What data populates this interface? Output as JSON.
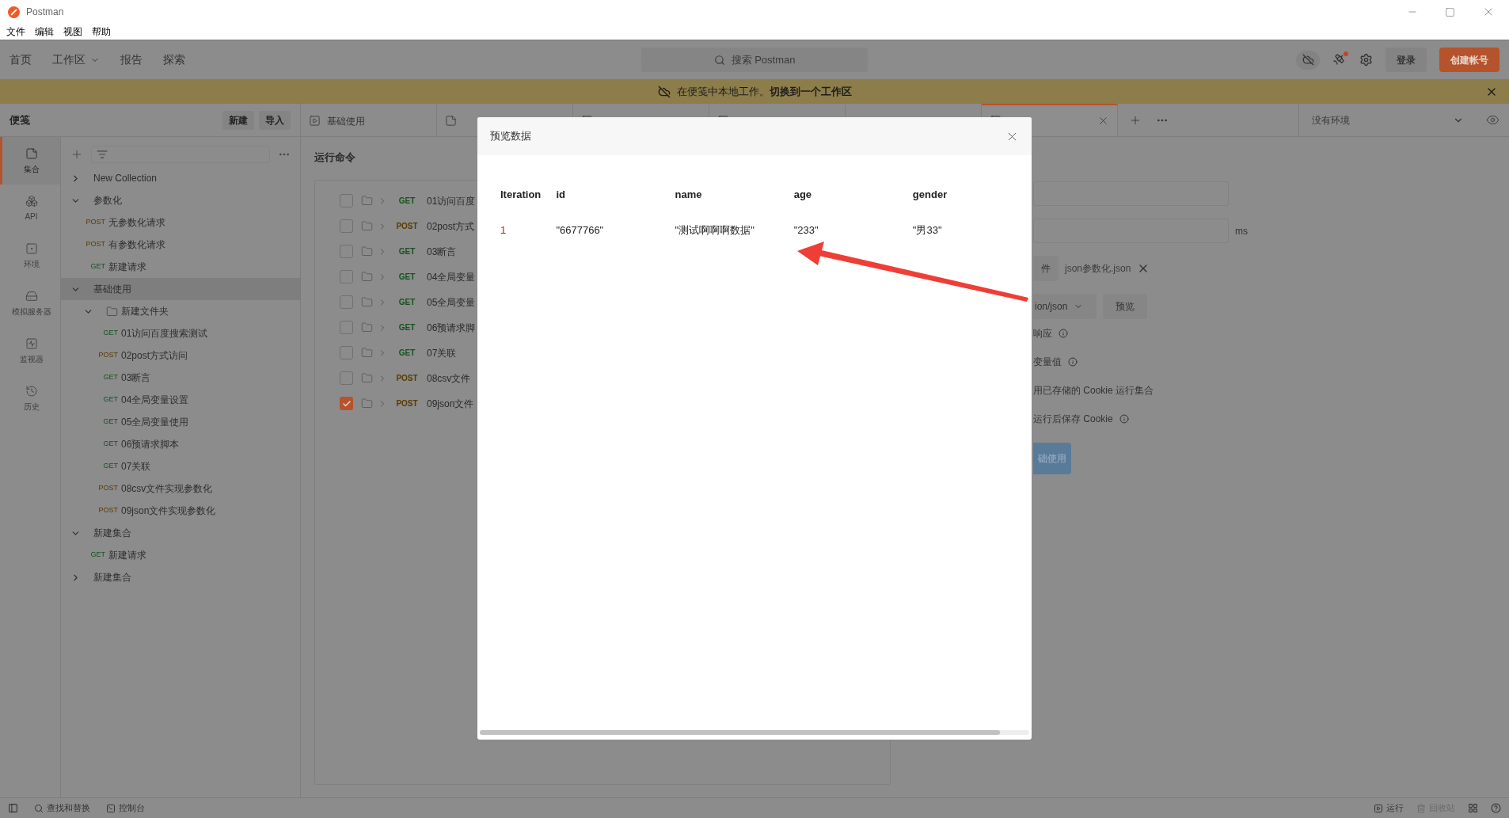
{
  "window": {
    "title": "Postman"
  },
  "menu": [
    "文件",
    "编辑",
    "视图",
    "帮助"
  ],
  "header": {
    "nav": [
      {
        "label": "首页",
        "dropdown": false
      },
      {
        "label": "工作区",
        "dropdown": true
      },
      {
        "label": "报告",
        "dropdown": false
      },
      {
        "label": "探索",
        "dropdown": false
      }
    ],
    "search": {
      "placeholder": "搜索 Postman"
    },
    "notification_dot": true,
    "buttons": [
      {
        "label": "登录",
        "kind": "secondary"
      },
      {
        "label": "创建帐号",
        "kind": "primary"
      }
    ]
  },
  "banner": {
    "text": "在便笺中本地工作。**切换到一个工作区**"
  },
  "sidebar": {
    "title": "便笺",
    "buttons": [
      "新建",
      "导入"
    ],
    "rail": [
      {
        "label": "集合",
        "selected": true
      },
      {
        "label": "API",
        "selected": false
      },
      {
        "label": "环境",
        "selected": false
      },
      {
        "label": "模拟服务器",
        "selected": false
      },
      {
        "label": "监视器",
        "selected": false
      },
      {
        "label": "历史",
        "selected": false
      }
    ],
    "tree": [
      {
        "kind": "collection",
        "label": "New Collection",
        "expanded": false,
        "selected": false
      },
      {
        "kind": "collection",
        "label": "参数化",
        "expanded": true,
        "selected": false,
        "children": [
          {
            "kind": "request",
            "method": "POST",
            "label": "无参数化请求",
            "selected": false
          },
          {
            "kind": "request",
            "method": "POST",
            "label": "有参数化请求",
            "selected": false
          },
          {
            "kind": "request",
            "method": "GET",
            "label": "新建请求",
            "selected": false
          }
        ]
      },
      {
        "kind": "collection",
        "label": "基础使用",
        "expanded": true,
        "selected": true,
        "children": [
          {
            "kind": "folder",
            "label": "新建文件夹",
            "expanded": true,
            "selected": false,
            "children": [
              {
                "kind": "request",
                "method": "GET",
                "label": "01访问百度搜索测试",
                "selected": false
              },
              {
                "kind": "request",
                "method": "POST",
                "label": "02post方式访问",
                "selected": false
              },
              {
                "kind": "request",
                "method": "GET",
                "label": "03断言",
                "selected": false
              },
              {
                "kind": "request",
                "method": "GET",
                "label": "04全局变量设置",
                "selected": false
              },
              {
                "kind": "request",
                "method": "GET",
                "label": "05全局变量使用",
                "selected": false
              },
              {
                "kind": "request",
                "method": "GET",
                "label": "06预请求脚本",
                "selected": false
              },
              {
                "kind": "request",
                "method": "GET",
                "label": "07关联",
                "selected": false
              },
              {
                "kind": "request",
                "method": "POST",
                "label": "08csv文件实现参数化",
                "selected": false
              },
              {
                "kind": "request",
                "method": "POST",
                "label": "09json文件实现参数化",
                "selected": false
              }
            ]
          }
        ]
      },
      {
        "kind": "collection",
        "label": "新建集合",
        "expanded": true,
        "selected": false,
        "children": [
          {
            "kind": "request",
            "method": "GET",
            "label": "新建请求",
            "selected": false
          }
        ]
      },
      {
        "kind": "collection",
        "label": "新建集合",
        "expanded": false,
        "selected": false
      }
    ]
  },
  "tabs": [
    {
      "kind": "runner",
      "label": "基础使用",
      "selected": false
    },
    {
      "kind": "collection",
      "selected": false
    },
    {
      "kind": "request",
      "selected": false
    },
    {
      "kind": "request",
      "selected": false
    },
    {
      "kind": "blank",
      "selected": false
    },
    {
      "kind": "request",
      "selected": true
    }
  ],
  "environment": {
    "label": "没有环境"
  },
  "runner": {
    "title": "运行命令",
    "items": [
      {
        "method": "GET",
        "name": "01访问百度",
        "checked": false
      },
      {
        "method": "POST",
        "name": "02post方式",
        "checked": false
      },
      {
        "method": "GET",
        "name": "03断言",
        "checked": false
      },
      {
        "method": "GET",
        "name": "04全局变量",
        "checked": false
      },
      {
        "method": "GET",
        "name": "05全局变量",
        "checked": false
      },
      {
        "method": "GET",
        "name": "06预请求脚",
        "checked": false
      },
      {
        "method": "GET",
        "name": "07关联",
        "checked": false
      },
      {
        "method": "POST",
        "name": "08csv文件",
        "checked": false
      },
      {
        "method": "POST",
        "name": "09json文件",
        "checked": true
      }
    ]
  },
  "settings": {
    "delay_unit": "ms",
    "file_button": "件",
    "file_name": "json参数化.json",
    "data_type": "ion/json",
    "preview_button": "预览",
    "options": [
      {
        "label": "响应",
        "info": true
      },
      {
        "label": "变量值",
        "info": true
      },
      {
        "label": "用已存储的 Cookie 运行集合",
        "info": false
      },
      {
        "label": "运行后保存 Cookie",
        "info": true
      }
    ],
    "run_button": "础使用"
  },
  "modal": {
    "title": "预览数据",
    "columns": [
      "Iteration",
      "id",
      "name",
      "age",
      "gender"
    ],
    "rows": [
      [
        "1",
        "\"6677766\"",
        "\"测试啊啊啊数据\"",
        "\"233\"",
        "\"男33\""
      ]
    ]
  },
  "status_bar": {
    "left": [
      {
        "label": "查找和替换"
      },
      {
        "label": "控制台"
      }
    ],
    "right": [
      {
        "label": "运行",
        "disabled": false
      },
      {
        "label": "回收站",
        "disabled": true
      }
    ]
  }
}
